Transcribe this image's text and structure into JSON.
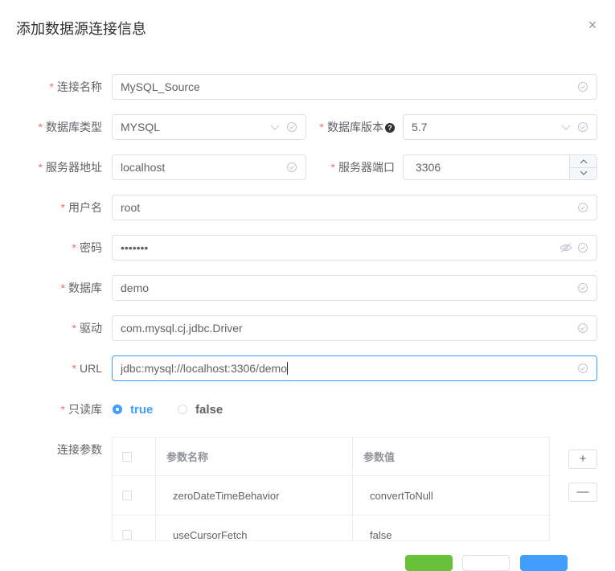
{
  "dialog": {
    "title": "添加数据源连接信息",
    "close": "×"
  },
  "colors": {
    "required": "#f56c6c",
    "primary": "#409eff",
    "success": "#67c23a",
    "border": "#dcdfe6"
  },
  "form": {
    "required_mark": "*",
    "conn_name": {
      "label": "连接名称",
      "value": "MySQL_Source"
    },
    "db_type": {
      "label": "数据库类型",
      "value": "MYSQL"
    },
    "db_version": {
      "label": "数据库版本",
      "help": "?",
      "value": "5.7"
    },
    "host": {
      "label": "服务器地址",
      "value": "localhost"
    },
    "port": {
      "label": "服务器端口",
      "value": "3306"
    },
    "username": {
      "label": "用户名",
      "value": "root"
    },
    "password": {
      "label": "密码",
      "value": "•••••••"
    },
    "database": {
      "label": "数据库",
      "value": "demo"
    },
    "driver": {
      "label": "驱动",
      "value": "com.mysql.cj.jdbc.Driver"
    },
    "url": {
      "label": "URL",
      "value": "jdbc:mysql://localhost:3306/demo"
    },
    "readonly": {
      "label": "只读库",
      "options": [
        "true",
        "false"
      ],
      "selected": "true"
    }
  },
  "params": {
    "label": "连接参数",
    "headers": [
      "参数名称",
      "参数值"
    ],
    "rows": [
      {
        "name": "zeroDateTimeBehavior",
        "value": "convertToNull"
      },
      {
        "name": "useCursorFetch",
        "value": "false"
      }
    ],
    "add": "+",
    "remove": "—"
  }
}
